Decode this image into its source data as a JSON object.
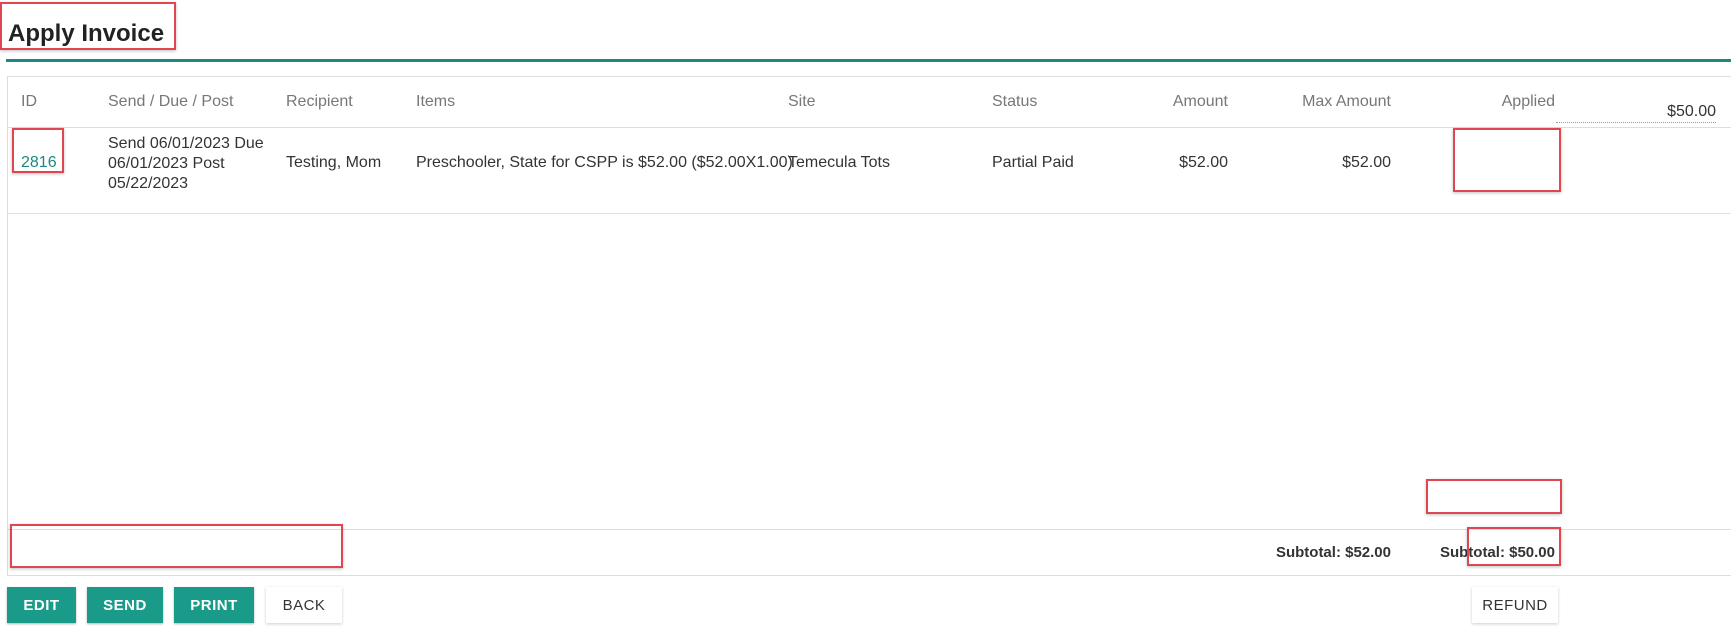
{
  "page": {
    "title": "Apply Invoice"
  },
  "table": {
    "headers": {
      "id": "ID",
      "dates": "Send / Due / Post",
      "recipient": "Recipient",
      "items": "Items",
      "site": "Site",
      "status": "Status",
      "amount": "Amount",
      "max_amount": "Max Amount",
      "applied": "Applied"
    },
    "rows": [
      {
        "id": "2816",
        "dates": "Send 06/01/2023 Due 06/01/2023 Post 05/22/2023",
        "recipient": "Testing, Mom",
        "items": "Preschooler, State for CSPP is $52.00 ($52.00X1.00)",
        "site": "Temecula Tots",
        "status": "Partial Paid",
        "amount": "$52.00",
        "max_amount": "$52.00",
        "applied": "$50.00"
      }
    ],
    "footer": {
      "subtotal_max": "Subtotal: $52.00",
      "subtotal_applied": "Subtotal: $50.00"
    }
  },
  "actions": {
    "edit": "EDIT",
    "send": "SEND",
    "print": "PRINT",
    "back": "BACK",
    "refund": "REFUND"
  },
  "colors": {
    "accent": "#1a9a88",
    "link": "#1a8a7e",
    "highlight": "#e0464f"
  }
}
